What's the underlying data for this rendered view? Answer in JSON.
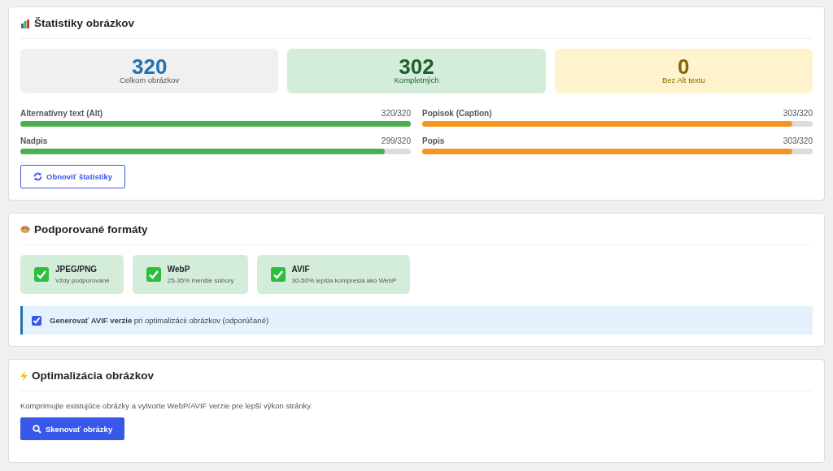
{
  "statistics": {
    "title": "Štatistiky obrázkov",
    "stats": [
      {
        "kind": "total",
        "value": "320",
        "label": "Celkom obrázkov"
      },
      {
        "kind": "complete",
        "value": "302",
        "label": "Kompletných"
      },
      {
        "kind": "missing",
        "value": "0",
        "label": "Bez Alt textu"
      }
    ],
    "progress": [
      {
        "label": "Alternatívny text (Alt)",
        "reading": "320/320",
        "level": 1,
        "color": "#4caf50"
      },
      {
        "label": "Popisok (Caption)",
        "reading": "303/320",
        "level": 0.947,
        "color": "#f7941d"
      },
      {
        "label": "Nadpis",
        "reading": "299/320",
        "level": 0.934,
        "color": "#4caf50"
      },
      {
        "label": "Popis",
        "reading": "303/320",
        "level": 0.947,
        "color": "#f7941d"
      }
    ],
    "refresh_button": "Obnoviť štatistiky"
  },
  "formats": {
    "title": "Podporované formáty",
    "items": [
      {
        "name": "JPEG/PNG",
        "note": "Vždy podporované"
      },
      {
        "name": "WebP",
        "note": "25-35% menšie súbory"
      },
      {
        "name": "AVIF",
        "note": "30-50% lepšia kompresia ako WebP"
      }
    ],
    "avif_option": {
      "label": "**Generovať AVIF verzie** pri optimalizácii obrázkov (odporúčané)",
      "checked": true
    }
  },
  "optimization": {
    "title": "Optimalizácia obrázkov",
    "description": "Komprimujte existujúce obrázky a vytvorte WebP/AVIF verzie pre lepší výkon stránky.",
    "scan_button": "Skenovať obrázky"
  }
}
